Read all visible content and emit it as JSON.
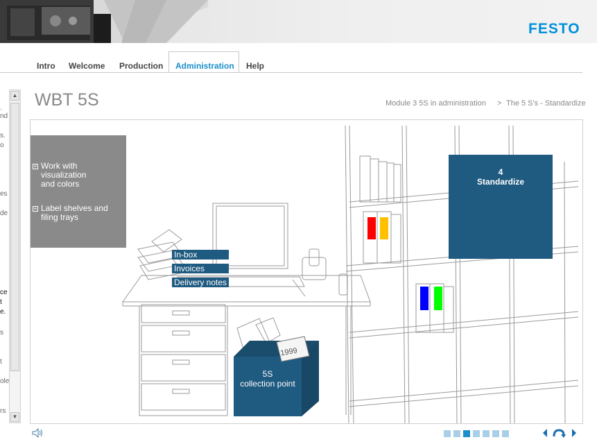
{
  "brand": {
    "logo_text": "FESTO",
    "accent": "#0091dc"
  },
  "nav": {
    "tabs": [
      {
        "label": "Intro"
      },
      {
        "label": "Welcome"
      },
      {
        "label": "Production"
      },
      {
        "label": "Administration",
        "active": true
      },
      {
        "label": "Help"
      }
    ]
  },
  "sidebar": {
    "fragments": [
      ".",
      "nd",
      "s.",
      "o",
      "es",
      "de",
      "ce",
      "t",
      "e.",
      "s",
      "t",
      "ole",
      "rs"
    ]
  },
  "page": {
    "title": "WBT 5S",
    "breadcrumb": {
      "module": "Module 3 5S in administration",
      "separator": ">",
      "current": "The 5 S's - Standardize"
    }
  },
  "stage": {
    "menu": [
      {
        "label_lines": [
          "Work with",
          "visualization",
          "and colors"
        ],
        "icon": "plus-box-icon"
      },
      {
        "label_lines": [
          "Label shelves and",
          "filing trays"
        ],
        "icon": "plus-box-icon"
      }
    ],
    "standardize": {
      "number": "4",
      "label": "Standardize"
    },
    "desk_tags": [
      "In-box",
      "Invoices",
      "Delivery notes"
    ],
    "collection": {
      "line1": "5S",
      "line2": "collection point",
      "paper_text": "1999"
    },
    "folder_colors": {
      "red": "#ff0000",
      "yellow": "#ffc000",
      "blue": "#0000ff",
      "green": "#00ff00"
    }
  },
  "footer": {
    "speaker_icon": "speaker-icon",
    "progress": {
      "total": 7,
      "current": 3
    },
    "controls": [
      "prev-arrow-icon",
      "replay-icon",
      "next-arrow-icon"
    ]
  },
  "colors": {
    "panel_blue": "#1f5a80",
    "panel_gray": "#8a8a8a",
    "active_tab": "#1a8fc9"
  }
}
